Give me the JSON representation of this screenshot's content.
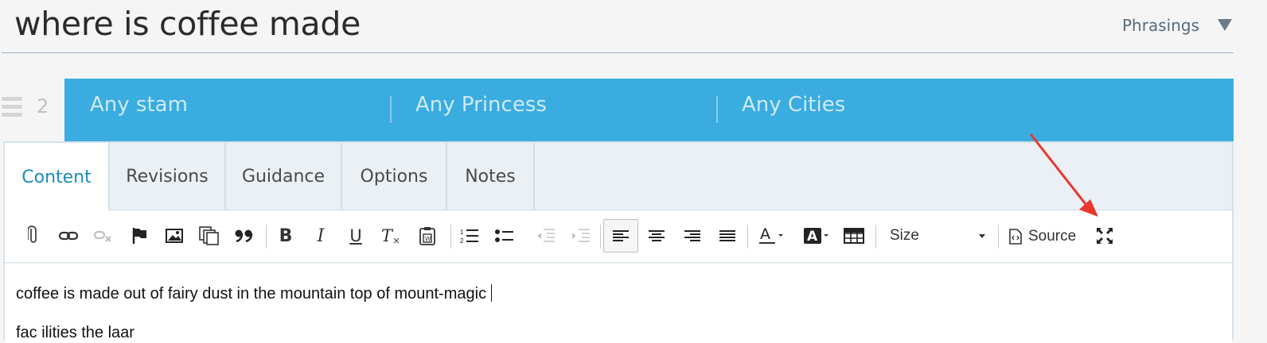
{
  "title": {
    "value": "where is coffee made"
  },
  "phrasings": {
    "label": "Phrasings"
  },
  "row": {
    "number": "2"
  },
  "slots": [
    "Any stam",
    "Any Princess",
    "Any Cities"
  ],
  "tabs": [
    "Content",
    "Revisions",
    "Guidance",
    "Options",
    "Notes"
  ],
  "active_tab": "Content",
  "toolbar": {
    "size_label": "Size",
    "source_label": "Source",
    "buttons": [
      "attach-icon",
      "link-icon",
      "unlink-icon",
      "anchor-flag-icon",
      "image-icon",
      "copy-icon",
      "blockquote-icon",
      "bold-icon",
      "italic-icon",
      "underline-icon",
      "remove-format-icon",
      "paste-word-icon",
      "numbered-list-icon",
      "bulleted-list-icon",
      "outdent-icon",
      "indent-icon",
      "align-left-icon",
      "align-center-icon",
      "align-right-icon",
      "justify-icon",
      "text-color-icon",
      "background-color-icon",
      "table-icon",
      "source-icon",
      "maximize-icon"
    ]
  },
  "editor": {
    "line1": "coffee is made out of fairy dust in the mountain top of mount-magic",
    "line2": "fac ilities  the  laar"
  },
  "colors": {
    "accent": "#3aace0",
    "tab_active": "#1b8bbf",
    "annotation_arrow": "#e8372c"
  }
}
